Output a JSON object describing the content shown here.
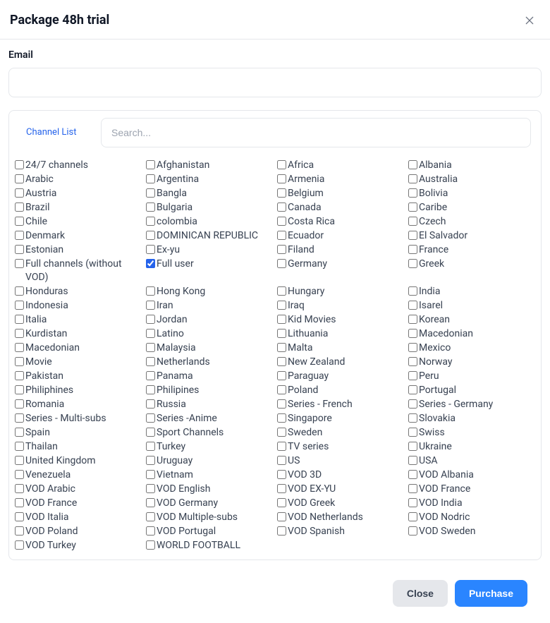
{
  "modal": {
    "title": "Package 48h trial"
  },
  "email": {
    "label": "Email",
    "value": ""
  },
  "channel": {
    "tab_label": "Channel List",
    "search_placeholder": "Search...",
    "items": [
      {
        "label": "24/7 channels",
        "checked": false
      },
      {
        "label": "Afghanistan",
        "checked": false
      },
      {
        "label": "Africa",
        "checked": false
      },
      {
        "label": "Albania",
        "checked": false
      },
      {
        "label": "Arabic",
        "checked": false
      },
      {
        "label": "Argentina",
        "checked": false
      },
      {
        "label": "Armenia",
        "checked": false
      },
      {
        "label": "Australia",
        "checked": false
      },
      {
        "label": "Austria",
        "checked": false
      },
      {
        "label": "Bangla",
        "checked": false
      },
      {
        "label": "Belgium",
        "checked": false
      },
      {
        "label": "Bolivia",
        "checked": false
      },
      {
        "label": "Brazil",
        "checked": false
      },
      {
        "label": "Bulgaria",
        "checked": false
      },
      {
        "label": "Canada",
        "checked": false
      },
      {
        "label": "Caribe",
        "checked": false
      },
      {
        "label": "Chile",
        "checked": false
      },
      {
        "label": "colombia",
        "checked": false
      },
      {
        "label": "Costa Rica",
        "checked": false
      },
      {
        "label": "Czech",
        "checked": false
      },
      {
        "label": "Denmark",
        "checked": false
      },
      {
        "label": "DOMINICAN REPUBLIC",
        "checked": false
      },
      {
        "label": "Ecuador",
        "checked": false
      },
      {
        "label": "El Salvador",
        "checked": false
      },
      {
        "label": "Estonian",
        "checked": false
      },
      {
        "label": "Ex-yu",
        "checked": false
      },
      {
        "label": "Filand",
        "checked": false
      },
      {
        "label": "France",
        "checked": false
      },
      {
        "label": "Full channels (without VOD)",
        "checked": false
      },
      {
        "label": "Full user",
        "checked": true
      },
      {
        "label": "Germany",
        "checked": false
      },
      {
        "label": "Greek",
        "checked": false
      },
      {
        "label": "Honduras",
        "checked": false
      },
      {
        "label": "Hong Kong",
        "checked": false
      },
      {
        "label": "Hungary",
        "checked": false
      },
      {
        "label": "India",
        "checked": false
      },
      {
        "label": "Indonesia",
        "checked": false
      },
      {
        "label": "Iran",
        "checked": false
      },
      {
        "label": "Iraq",
        "checked": false
      },
      {
        "label": "Isarel",
        "checked": false
      },
      {
        "label": "Italia",
        "checked": false
      },
      {
        "label": "Jordan",
        "checked": false
      },
      {
        "label": "Kid Movies",
        "checked": false
      },
      {
        "label": "Korean",
        "checked": false
      },
      {
        "label": "Kurdistan",
        "checked": false
      },
      {
        "label": "Latino",
        "checked": false
      },
      {
        "label": "Lithuania",
        "checked": false
      },
      {
        "label": "Macedonian",
        "checked": false
      },
      {
        "label": "Macedonian",
        "checked": false
      },
      {
        "label": "Malaysia",
        "checked": false
      },
      {
        "label": "Malta",
        "checked": false
      },
      {
        "label": "Mexico",
        "checked": false
      },
      {
        "label": "Movie",
        "checked": false
      },
      {
        "label": "Netherlands",
        "checked": false
      },
      {
        "label": "New Zealand",
        "checked": false
      },
      {
        "label": "Norway",
        "checked": false
      },
      {
        "label": "Pakistan",
        "checked": false
      },
      {
        "label": "Panama",
        "checked": false
      },
      {
        "label": "Paraguay",
        "checked": false
      },
      {
        "label": "Peru",
        "checked": false
      },
      {
        "label": "Philiphines",
        "checked": false
      },
      {
        "label": "Philipines",
        "checked": false
      },
      {
        "label": "Poland",
        "checked": false
      },
      {
        "label": "Portugal",
        "checked": false
      },
      {
        "label": "Romania",
        "checked": false
      },
      {
        "label": "Russia",
        "checked": false
      },
      {
        "label": "Series - French",
        "checked": false
      },
      {
        "label": "Series - Germany",
        "checked": false
      },
      {
        "label": "Series - Multi-subs",
        "checked": false
      },
      {
        "label": "Series -Anime",
        "checked": false
      },
      {
        "label": "Singapore",
        "checked": false
      },
      {
        "label": "Slovakia",
        "checked": false
      },
      {
        "label": "Spain",
        "checked": false
      },
      {
        "label": "Sport Channels",
        "checked": false
      },
      {
        "label": "Sweden",
        "checked": false
      },
      {
        "label": "Swiss",
        "checked": false
      },
      {
        "label": "Thailan",
        "checked": false
      },
      {
        "label": "Turkey",
        "checked": false
      },
      {
        "label": "TV series",
        "checked": false
      },
      {
        "label": "Ukraine",
        "checked": false
      },
      {
        "label": "United Kingdom",
        "checked": false
      },
      {
        "label": "Uruguay",
        "checked": false
      },
      {
        "label": "US",
        "checked": false
      },
      {
        "label": "USA",
        "checked": false
      },
      {
        "label": "Venezuela",
        "checked": false
      },
      {
        "label": "Vietnam",
        "checked": false
      },
      {
        "label": "VOD 3D",
        "checked": false
      },
      {
        "label": "VOD Albania",
        "checked": false
      },
      {
        "label": "VOD Arabic",
        "checked": false
      },
      {
        "label": "VOD English",
        "checked": false
      },
      {
        "label": "VOD EX-YU",
        "checked": false
      },
      {
        "label": "VOD France",
        "checked": false
      },
      {
        "label": "VOD France",
        "checked": false
      },
      {
        "label": "VOD Germany",
        "checked": false
      },
      {
        "label": "VOD Greek",
        "checked": false
      },
      {
        "label": "VOD India",
        "checked": false
      },
      {
        "label": "VOD Italia",
        "checked": false
      },
      {
        "label": "VOD Multiple-subs",
        "checked": false
      },
      {
        "label": "VOD Netherlands",
        "checked": false
      },
      {
        "label": "VOD Nodric",
        "checked": false
      },
      {
        "label": "VOD Poland",
        "checked": false
      },
      {
        "label": "VOD Portugal",
        "checked": false
      },
      {
        "label": "VOD Spanish",
        "checked": false
      },
      {
        "label": "VOD Sweden",
        "checked": false
      },
      {
        "label": "VOD Turkey",
        "checked": false
      },
      {
        "label": "WORLD FOOTBALL",
        "checked": false
      }
    ]
  },
  "footer": {
    "close_label": "Close",
    "purchase_label": "Purchase"
  }
}
